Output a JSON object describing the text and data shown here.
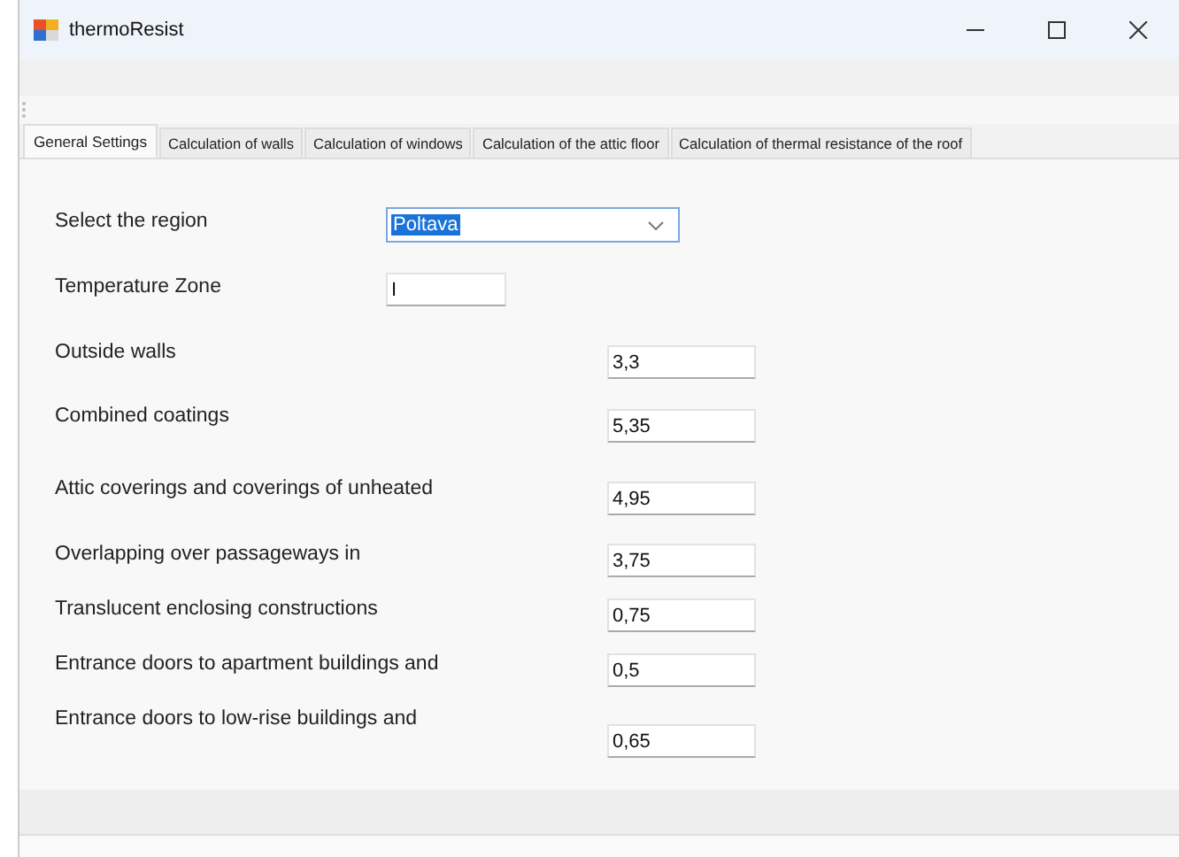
{
  "window": {
    "title": "thermoResist"
  },
  "tabs": [
    {
      "label": "General Settings",
      "selected": true
    },
    {
      "label": "Calculation of walls",
      "selected": false
    },
    {
      "label": "Calculation of windows",
      "selected": false
    },
    {
      "label": "Calculation of the attic floor",
      "selected": false
    },
    {
      "label": "Calculation of thermal resistance of the roof",
      "selected": false
    }
  ],
  "fields": [
    {
      "kind": "combo",
      "label": "Select the region",
      "value": "Poltava",
      "text_selected": true
    },
    {
      "kind": "short",
      "label": "Temperature Zone",
      "value": "I"
    },
    {
      "kind": "value",
      "label": "Outside walls",
      "value": "3,3"
    },
    {
      "kind": "value",
      "label": "Combined coatings",
      "value": "5,35"
    },
    {
      "kind": "value",
      "label": "Attic coverings and coverings of unheated",
      "value": "4,95"
    },
    {
      "kind": "value",
      "label": "Overlapping over passageways in",
      "value": "3,75"
    },
    {
      "kind": "value",
      "label": "Translucent enclosing constructions",
      "value": "0,75"
    },
    {
      "kind": "value",
      "label": "Entrance doors to apartment buildings and",
      "value": "0,5"
    },
    {
      "kind": "value",
      "label": "Entrance doors to low-rise buildings and",
      "value": "0,65"
    }
  ]
}
